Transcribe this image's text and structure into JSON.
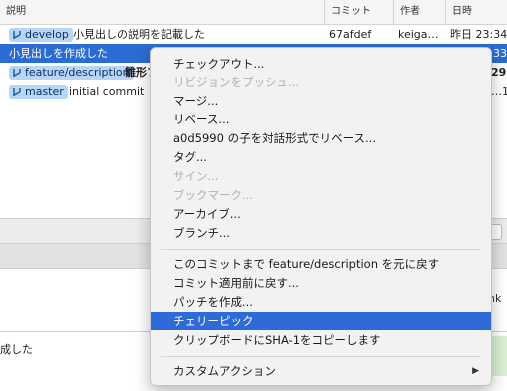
{
  "table": {
    "headers": [
      "説明",
      "コミット",
      "作者",
      "日時"
    ],
    "rows": [
      {
        "branch": "develop",
        "message": "小見出しの説明を記載した",
        "commit": "67afdef",
        "author": "keiga…",
        "date": "昨日 23:34"
      },
      {
        "message": "小見出しを作成した",
        "date_partial": "33"
      },
      {
        "branch": "feature/description",
        "message": "雛形フ",
        "date_partial": "29"
      },
      {
        "branch": "master",
        "message": "initial commit",
        "date_partial": "…1"
      }
    ]
  },
  "context_menu": {
    "items": [
      {
        "label": "チェックアウト...",
        "enabled": true
      },
      {
        "label": "リビジョンをプッシュ...",
        "enabled": false
      },
      {
        "label": "マージ...",
        "enabled": true
      },
      {
        "label": "リベース...",
        "enabled": true
      },
      {
        "label": "a0d5990 の子を対話形式でリベース...",
        "enabled": true
      },
      {
        "label": "タグ...",
        "enabled": true
      },
      {
        "label": "サイン...",
        "enabled": false
      },
      {
        "label": "ブックマーク...",
        "enabled": false
      },
      {
        "label": "アーカイブ...",
        "enabled": true
      },
      {
        "label": "ブランチ...",
        "enabled": true
      },
      {
        "label": "このコミットまで feature/description を元に戻す",
        "enabled": true
      },
      {
        "label": "コミット適用前に戻す...",
        "enabled": true
      },
      {
        "label": "パッチを作成...",
        "enabled": true
      },
      {
        "label": "チェリーピック",
        "enabled": true,
        "highlighted": true
      },
      {
        "label": "クリップボードにSHA-1をコピーします",
        "enabled": true
      },
      {
        "label": "カスタムアクション",
        "enabled": true,
        "submenu": true
      }
    ]
  },
  "panels": {
    "right_text": "nk",
    "bottom_text": "成した"
  },
  "colors": {
    "selection": "#2b6cd4",
    "branch_tag": "#b6d6f6",
    "menu_highlight": "#2f6bd8"
  }
}
